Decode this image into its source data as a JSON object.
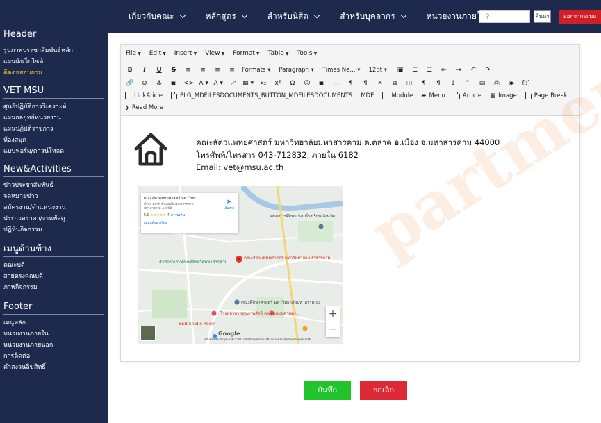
{
  "topnav": {
    "items": [
      {
        "label": "เกี่ยวกับคณะ"
      },
      {
        "label": "หลักสูตร"
      },
      {
        "label": "สำหรับนิสิต"
      },
      {
        "label": "สำหรับบุคลากร"
      },
      {
        "label": "หน่วยงานภายใน"
      }
    ],
    "search_button": "ค้นหา",
    "logout_button": "ออกจากระบบ"
  },
  "sidebar": {
    "sections": [
      {
        "heading": "Header",
        "items": [
          "รูปภาพประชาสัมพันธ์หลัก",
          "แผนผังเว็บไซต์",
          "ติดต่อสอบถาม"
        ]
      },
      {
        "heading": "VET MSU",
        "items": [
          "ศูนย์ปฏิบัติการวิเคราะห์",
          "แผนกลยุทธ์หน่วยงาน",
          "แผนปฏิบัติราชการ",
          "ห้องสมุด",
          "แบบฟอร์ม/ดาวน์โหลด"
        ]
      },
      {
        "heading": "New&Activities",
        "items": [
          "ข่าวประชาสัมพันธ์",
          "จดหมายข่าว",
          "สมัครงาน/ตำแหน่งงาน",
          "ประกวดราคา/งานพัสดุ",
          "ปฏิทินกิจกรรม"
        ]
      },
      {
        "heading": "เมนูด้านข้าง",
        "items": [
          "คณะบดี",
          "สายตรงคณบดี",
          "ภาพกิจกรรม"
        ]
      },
      {
        "heading": "Footer",
        "items": [
          "เมนูหลัก",
          "หน่วยงานภายใน",
          "หน่วยงานภายนอก",
          "การติดต่อ",
          "คำสงวนลิขสิทธิ์"
        ]
      }
    ],
    "active_item": "ติดต่อสอบถาม"
  },
  "editor": {
    "menubar": [
      "File",
      "Edit",
      "Insert",
      "View",
      "Format",
      "Table",
      "Tools"
    ],
    "formats_label": "Formats",
    "paragraph_label": "Paragraph",
    "font_label": "Times Ne...",
    "size_label": "12pt",
    "row3_buttons": [
      "LinkAticle",
      "PLG_MDFILESDOCUMENTS_BUTTON_MDFILESDOCUMENTS",
      "MDE",
      "Module",
      "Menu",
      "Article",
      "Image",
      "Page Break"
    ],
    "read_more": "Read More"
  },
  "content": {
    "address_line1": "คณะสัตวแพทยศาสตร์ มหาวิทยาลัยมหาสารคาม ต.ตลาด อ.เมือง จ.มหาสารคาม 44000",
    "address_line2": "โทรศัพท์/โทรสาร 043-712832, ภายใน 6182",
    "address_line3": "Email: vet@msu.ac.th"
  },
  "map": {
    "card_title": "คณะสัตวแพทยศาสตร์ มหาวิทยา...",
    "card_address": "ตำบล ตลาด อำเภอเมืองมหาสารคาม มหาสารคาม 44000",
    "card_rating": "5.0",
    "card_reviews": "4 ความเห็น",
    "card_link": "ดูแผนที่ขยายใหญ่",
    "card_directions": "เส้นทาง",
    "labels": [
      "คณะสัตวแพทยศาสตร์ มหาวิทยาลัยมหาสารคาม",
      "คณะศึกษาศาสตร์ มหาวิทยาลัยมหาสารคาม",
      "โรงพยาบาลสุขภาพสัตว์ คณะแพทยศาสตร์...",
      "B&B Studio Room",
      "คณะการศึกษา นอกโรงเรียน จังหวัด...",
      "สำนักงานบังคับคดีจังหวัดมหาสารคาม"
    ],
    "google": "Google",
    "footer": "แป้นพิมพ์ลัด ข้อมูลแผนที่ ©2022 ข้อกำหนดในการใช้งาน รายงานข้อผิดพลาดของแผนที่"
  },
  "buttons": {
    "save": "บันทึก",
    "cancel": "ยกเลิก"
  },
  "watermark": "partment of..."
}
